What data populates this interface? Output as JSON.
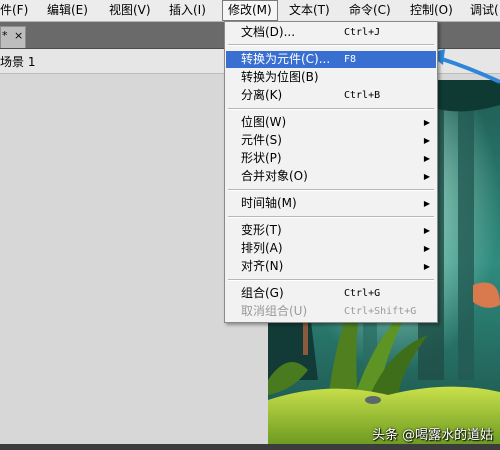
{
  "menubar": {
    "items": [
      {
        "label": "件(F)"
      },
      {
        "label": "编辑(E)"
      },
      {
        "label": "视图(V)"
      },
      {
        "label": "插入(I)"
      },
      {
        "label": "修改(M)"
      },
      {
        "label": "文本(T)"
      },
      {
        "label": "命令(C)"
      },
      {
        "label": "控制(O)"
      },
      {
        "label": "调试("
      }
    ]
  },
  "tabs": {
    "modified_marker": "*",
    "close_glyph": "×"
  },
  "scene": {
    "label": "场景 1"
  },
  "modify_menu": {
    "items": [
      {
        "label": "文档(D)...",
        "shortcut": "Ctrl+J"
      },
      {
        "label": "转换为元件(C)...",
        "shortcut": "F8"
      },
      {
        "label": "转换为位图(B)",
        "shortcut": ""
      },
      {
        "label": "分离(K)",
        "shortcut": "Ctrl+B"
      },
      {
        "label": "位图(W)"
      },
      {
        "label": "元件(S)"
      },
      {
        "label": "形状(P)"
      },
      {
        "label": "合并对象(O)"
      },
      {
        "label": "时间轴(M)"
      },
      {
        "label": "变形(T)"
      },
      {
        "label": "排列(A)"
      },
      {
        "label": "对齐(N)"
      },
      {
        "label": "组合(G)",
        "shortcut": "Ctrl+G"
      },
      {
        "label": "取消组合(U)",
        "shortcut": "Ctrl+Shift+G"
      }
    ],
    "submenu_arrow": "▶"
  },
  "watermark": {
    "text": "头条 @喝露水的道姑"
  },
  "colors": {
    "highlight": "#3a6fd2",
    "annotation_arrow": "#2f86d8"
  }
}
